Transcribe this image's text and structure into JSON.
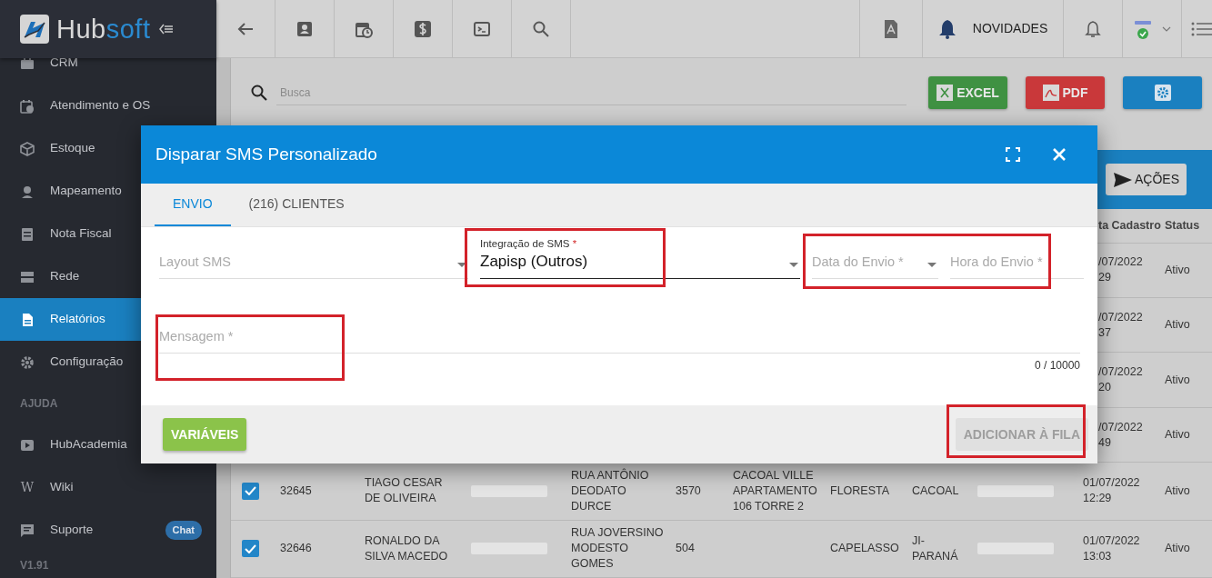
{
  "sidebar": {
    "logo": {
      "part_a": "Hub",
      "part_b": "soft"
    },
    "items": [
      {
        "label": "CRM",
        "selected": false
      },
      {
        "label": "Atendimento e OS",
        "selected": false
      },
      {
        "label": "Estoque",
        "selected": false
      },
      {
        "label": "Mapeamento",
        "selected": false
      },
      {
        "label": "Nota Fiscal",
        "selected": false
      },
      {
        "label": "Rede",
        "selected": false
      },
      {
        "label": "Relatórios",
        "selected": true
      },
      {
        "label": "Configuração",
        "selected": false
      }
    ],
    "help": {
      "heading": "AJUDA",
      "items": [
        {
          "label": "HubAcademia",
          "kind": "video"
        },
        {
          "label": "Wiki",
          "kind": "letter",
          "icon_char": "W"
        },
        {
          "label": "Suporte",
          "kind": "chat",
          "badge": "Chat"
        }
      ]
    },
    "version": "V1.91"
  },
  "topbar": {
    "news_label": "NOVIDADES"
  },
  "toolbar": {
    "search": {
      "placeholder": "Busca"
    },
    "buttons": [
      {
        "label": "EXCEL",
        "kind": "excel"
      },
      {
        "label": "PDF",
        "kind": "pdf"
      },
      {
        "kind": "settings"
      }
    ]
  },
  "panel": {
    "actions_button": "AÇÕES"
  },
  "table": {
    "columns": [
      "ta Cadastro",
      "Status"
    ],
    "hidden_rows": [
      {
        "data_cadastro": "/07/2022\n29",
        "status": "Ativo"
      },
      {
        "data_cadastro": "/07/2022\n37",
        "status": "Ativo"
      },
      {
        "data_cadastro": "/07/2022\n20",
        "status": "Ativo"
      },
      {
        "data_cadastro": "/07/2022\n49",
        "status": "Ativo"
      }
    ],
    "rows": [
      {
        "checked": true,
        "column_2": "32645",
        "column_3": "TIAGO CESAR DE OLIVEIRA",
        "column_5": "RUA ANTÔNIO DEODATO DURCE",
        "column_6": "3570",
        "column_7": "CACOAL VILLE APARTAMENTO 106 TORRE 2",
        "column_8": "FLORESTA",
        "column_9": "CACOAL",
        "data_cadastro": "01/07/2022 12:29",
        "status": "Ativo"
      },
      {
        "checked": true,
        "column_2": "32646",
        "column_3": "RONALDO DA SILVA MACEDO",
        "column_5": "RUA JOVERSINO MODESTO GOMES",
        "column_6": "504",
        "column_8": "CAPELASSO",
        "column_9": "JI-PARANÁ",
        "data_cadastro": "01/07/2022 13:03",
        "status": "Ativo"
      }
    ]
  },
  "modal": {
    "title": "Disparar SMS Personalizado",
    "tabs": [
      {
        "label": "ENVIO",
        "selected": true
      },
      {
        "label": "(216) CLIENTES",
        "selected": false
      }
    ],
    "fields": [
      {
        "kind": "select",
        "label": "Layout SMS"
      },
      {
        "kind": "select",
        "label": "Integração de SMS",
        "required_mark": "*",
        "value": "Zapisp (Outros)"
      },
      {
        "kind": "select",
        "label": "Data do Envio",
        "required_mark": "*"
      },
      {
        "kind": "text",
        "label": "Hora do Envio",
        "required_mark": "*"
      }
    ],
    "message": {
      "label": "Mensagem",
      "required_mark": "*",
      "counter": "0 / 10000"
    },
    "buttons": [
      {
        "label": "VARIÁVEIS",
        "disabled": false
      },
      {
        "label": "ADICIONAR À FILA",
        "disabled": true
      }
    ]
  }
}
